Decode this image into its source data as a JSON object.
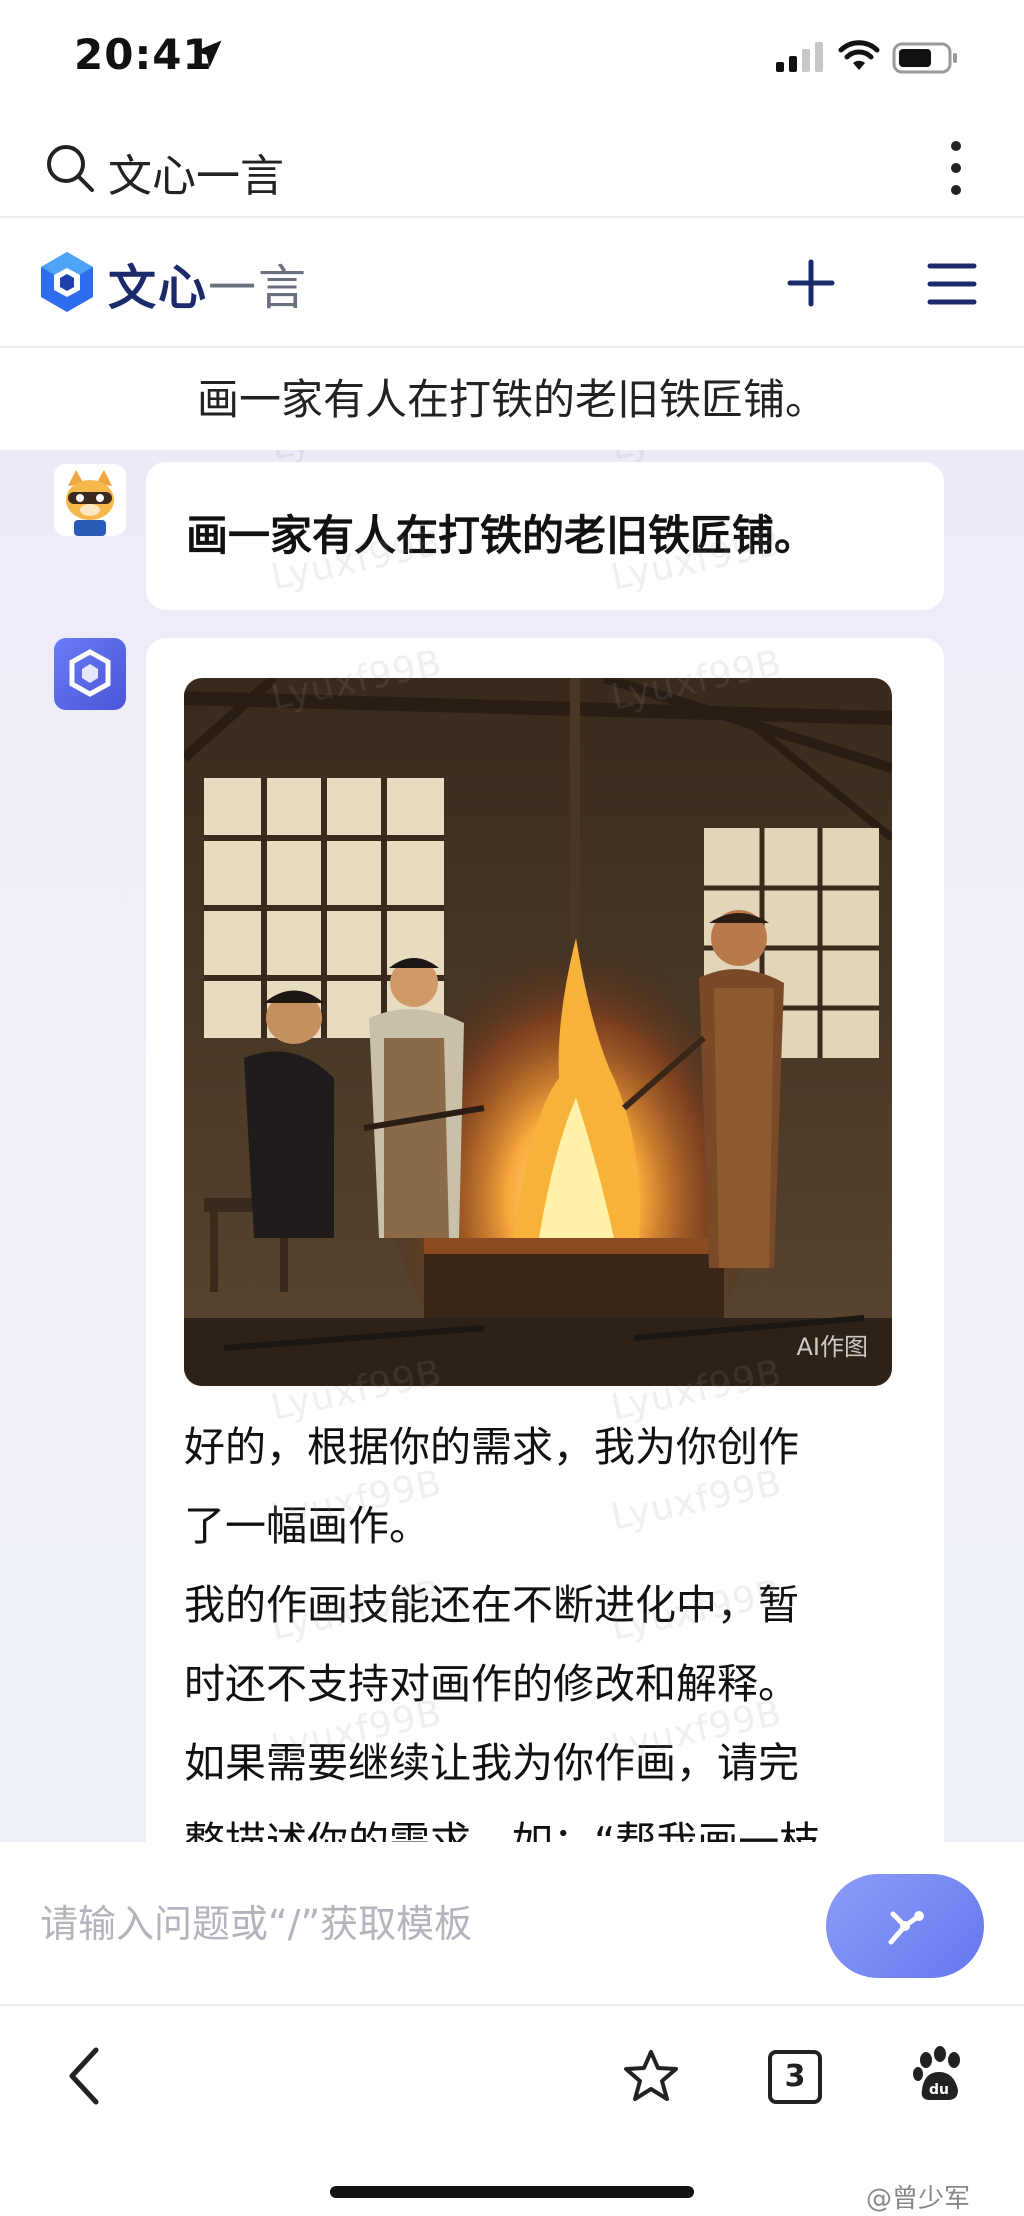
{
  "status_bar": {
    "time": "20:41"
  },
  "browser": {
    "search_text": "文心一言"
  },
  "app_header": {
    "logo_bold": "文心",
    "logo_light": "一言"
  },
  "conversation": {
    "title": "画一家有人在打铁的老旧铁匠铺。"
  },
  "messages": {
    "user_text": "画一家有人在打铁的老旧铁匠铺。",
    "image_badge": "AI作图",
    "bot_lines": [
      "好的，根据你的需求，我为你创作",
      "了一幅画作。",
      "我的作画技能还在不断进化中，暂",
      "时还不支持对画作的修改和解释。",
      "如果需要继续让我为你作画，请完",
      "整描述你的需求，如：“帮我画一枝"
    ]
  },
  "input": {
    "placeholder": "请输入问题或“/”获取模板"
  },
  "bottom_nav": {
    "tab_count": "3"
  },
  "watermark_text": "Lyuxf99B",
  "credit": "@曾少军",
  "icons": {
    "status": [
      "location-arrow-icon",
      "signal-icon",
      "wifi-icon",
      "battery-icon"
    ],
    "browser": [
      "search-icon",
      "more-vertical-icon"
    ],
    "app": [
      "wenxin-logo-icon",
      "plus-icon",
      "hamburger-menu-icon"
    ],
    "nav": [
      "back-chevron-icon",
      "star-icon",
      "tabs-icon",
      "baidu-paw-icon"
    ],
    "send": "send-icon"
  },
  "colors": {
    "brand_dark": "#1b2a6b",
    "accent": "#6478ef",
    "chat_bg": "#ecebf8"
  }
}
